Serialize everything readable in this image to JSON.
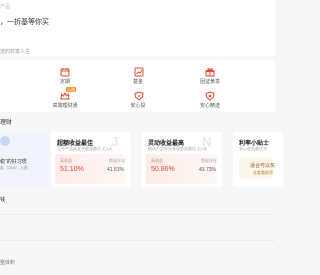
{
  "header": {
    "breadcrumb": "产品",
    "slogan": "，一折基等你买",
    "section_title": "选的财富人生"
  },
  "services": [
    {
      "name": "service-dingqi",
      "label": "定期",
      "icon": "calendar-icon"
    },
    {
      "name": "service-jijin",
      "label": "基金",
      "icon": "fund-icon"
    },
    {
      "name": "service-zhuanyu",
      "label": "固证黄享",
      "icon": "gift-icon"
    },
    {
      "name": "service-gaoduan",
      "label": "高端理财通",
      "icon": "crown-icon",
      "badge": "入选"
    },
    {
      "name": "service-anxin",
      "label": "安心投",
      "icon": "shield-icon"
    },
    {
      "name": "service-anxin-pick",
      "label": "安心精选",
      "icon": "heart-shield-icon"
    }
  ],
  "wealth": {
    "title": "理财"
  },
  "cards": [
    {
      "title": "",
      "line1": "稳\"的好习惯",
      "line2": "起（Q08）入图"
    },
    {
      "title": "超额收益最佳",
      "subtitle": "至今产品成长中收益最佳 近1天",
      "left_label": "高收益",
      "left_value": "51.10%",
      "right_label": "数据年化",
      "right_value": "41.51%",
      "watermark": "J"
    },
    {
      "title": "灵动收益最高",
      "subtitle": "精选产品年化表现收益最佳 近1年",
      "left_label": "高收益",
      "left_value": "50.86%",
      "right_label": "数据年化",
      "right_value": "43.73%",
      "watermark": "N"
    },
    {
      "title": "利率小贴士",
      "subtitle": "安心收益最优秀",
      "box_line1": "适合可以买",
      "box_line2": "去看看推荐"
    }
  ],
  "sections": {
    "lower_title": "钱",
    "bottom_text": "整体积"
  },
  "colors": {
    "accent_red": "#e8492f",
    "accent_orange": "#f19a2f",
    "background": "#f7f7f7"
  }
}
